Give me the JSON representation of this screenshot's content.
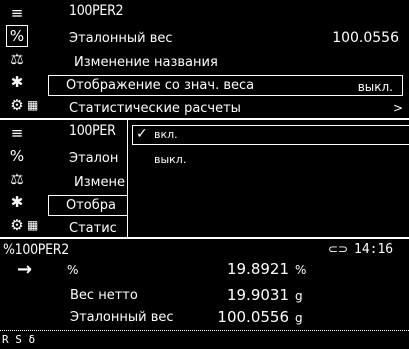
{
  "menu": {
    "title": "100PER2",
    "items": [
      {
        "label": "Эталонный вес",
        "value": "100.0556"
      },
      {
        "label": "Изменение названия"
      },
      {
        "label": "Отображение со знач. веса",
        "value": "выкл."
      },
      {
        "label": "Статистические расчеты",
        "arrow": ">"
      }
    ]
  },
  "side_icons": [
    "≡",
    "%",
    "⚖",
    "✱",
    "⚙"
  ],
  "popup": {
    "title_partial": "100PER",
    "options": [
      {
        "label": "вкл.",
        "check": "✓"
      },
      {
        "label": "выкл."
      }
    ],
    "truncated_items": [
      "Эталон",
      "Измене",
      "Отобра",
      "Статис"
    ]
  },
  "display": {
    "mode_title": "%100PER2",
    "time": "14:16",
    "rows": [
      {
        "marker": "→",
        "label": "%",
        "value": "19.8921",
        "unit": "%"
      },
      {
        "label": "Вес нетто",
        "value": "19.9031",
        "unit": "g"
      },
      {
        "label": "Эталонный вес",
        "value": "100.0556",
        "unit": "g"
      }
    ],
    "status_line": "R   S  δ"
  }
}
